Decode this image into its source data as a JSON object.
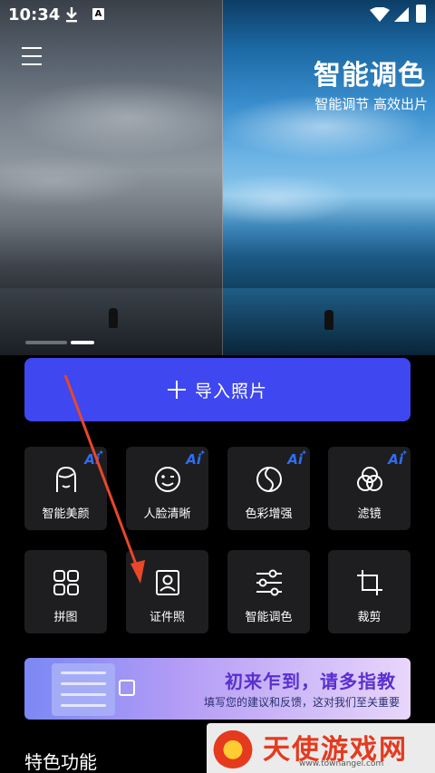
{
  "status_bar": {
    "time": "10:34",
    "a_badge": "A"
  },
  "hero": {
    "title": "智能调色",
    "subtitle": "智能调节 高效出片",
    "carousel_count": 2,
    "carousel_active": 2
  },
  "import_button": {
    "label": "导入照片"
  },
  "features": [
    {
      "label": "智能美颜",
      "icon": "face-beauty-icon",
      "ai": true
    },
    {
      "label": "人脸清晰",
      "icon": "face-smile-icon",
      "ai": true
    },
    {
      "label": "色彩增强",
      "icon": "color-enhance-icon",
      "ai": true
    },
    {
      "label": "滤镜",
      "icon": "filter-icon",
      "ai": true
    },
    {
      "label": "拼图",
      "icon": "collage-icon",
      "ai": false
    },
    {
      "label": "证件照",
      "icon": "id-photo-icon",
      "ai": false
    },
    {
      "label": "智能调色",
      "icon": "adjust-sliders-icon",
      "ai": false
    },
    {
      "label": "裁剪",
      "icon": "crop-icon",
      "ai": false
    }
  ],
  "ai_badge": "Ai",
  "promo": {
    "title": "初来乍到，请多指教",
    "subtitle": "填写您的建议和反馈，这对我们至关重要"
  },
  "section_title": "特色功能",
  "watermark": {
    "text": "天使游戏网",
    "url": "www.townangel.com"
  },
  "colors": {
    "accent": "#3e47f0",
    "tile_bg": "#1e1e20",
    "annotation_arrow": "#e8472a"
  }
}
